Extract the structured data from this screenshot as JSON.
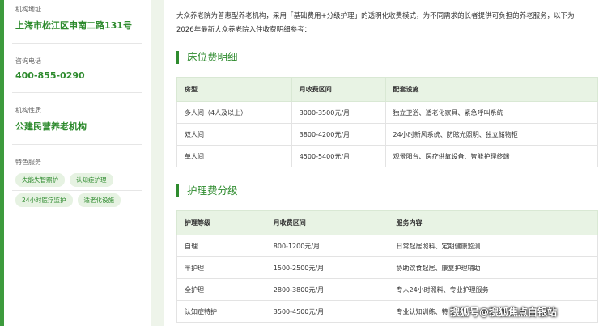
{
  "sidebar": {
    "address_label": "机构地址",
    "address_value": "上海市松江区申南二路131号",
    "phone_label": "咨询电话",
    "phone_value": "400-855-0290",
    "nature_label": "机构性质",
    "nature_value": "公建民营养老机构",
    "services_label": "特色服务",
    "tags": [
      "失能失智照护",
      "认知症护理",
      "24小时医疗监护",
      "适老化设施"
    ]
  },
  "intro": "大众养老院为普惠型养老机构，采用「基础费用+分级护理」的透明化收费模式，为不同需求的长者提供可负担的养老服务，以下为2026年最新大众养老院入住收费明细参考：",
  "bed_section": {
    "title": "床位费明细",
    "headers": [
      "房型",
      "月收费区间",
      "配套设施"
    ],
    "rows": [
      [
        "多人间（4人及以上）",
        "3000-3500元/月",
        "独立卫浴、适老化家具、紧急呼叫系统"
      ],
      [
        "双人间",
        "3800-4200元/月",
        "24小时新风系统、防眩光照明、独立储物柜"
      ],
      [
        "单人间",
        "4500-5400元/月",
        "观景阳台、医疗供氧设备、智能护理终端"
      ]
    ]
  },
  "care_section": {
    "title": "护理费分级",
    "headers": [
      "护理等级",
      "月收费区间",
      "服务内容"
    ],
    "rows": [
      [
        "自理",
        "800-1200元/月",
        "日常起居照料、定期健康监测"
      ],
      [
        "半护理",
        "1500-2500元/月",
        "协助饮食起居、康复护理辅助"
      ],
      [
        "全护理",
        "2800-3800元/月",
        "专人24小时照料、专业护理服务"
      ],
      [
        "认知症特护",
        "3500-4500元/月",
        "专业认知训练、特"
      ]
    ]
  },
  "watermark": "搜狐号@搜狐焦点白银站"
}
